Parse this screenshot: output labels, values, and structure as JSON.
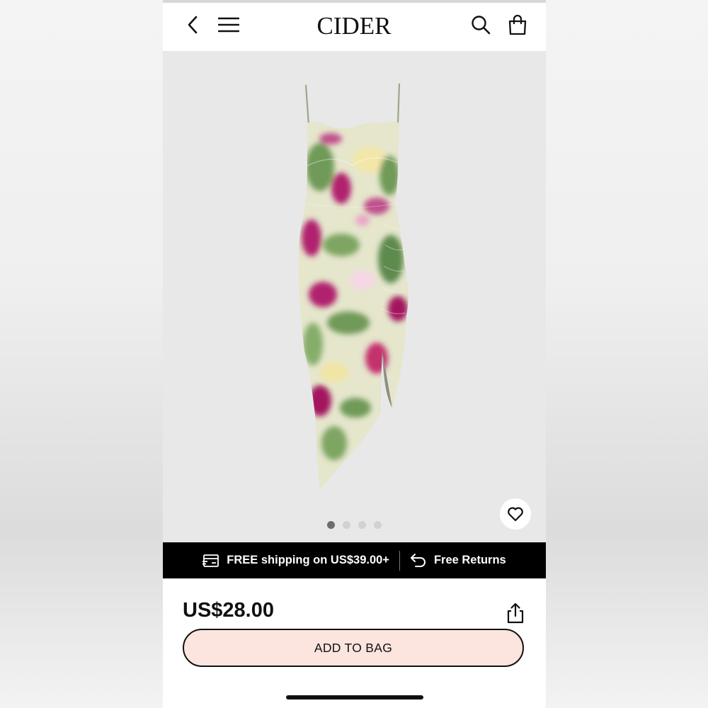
{
  "header": {
    "logo": "CIDER",
    "icons": [
      "back-arrow-icon",
      "hamburger-menu-icon",
      "search-icon",
      "shopping-bag-icon"
    ]
  },
  "gallery": {
    "total_images": 4,
    "current_index": 1,
    "favorite_icon": "heart-icon"
  },
  "shipping_bar": {
    "shipping_text": "FREE shipping on US$39.00+",
    "returns_text": "Free Returns",
    "shipping_icon": "shipping-card-icon",
    "returns_icon": "return-arrow-icon"
  },
  "product": {
    "price": "US$28.00",
    "share_icon": "share-icon",
    "add_to_bag_label": "ADD TO BAG"
  },
  "colors": {
    "add_to_bag_bg": "#fce4df",
    "shipping_bar_bg": "#000000",
    "gallery_bg": "#e8e8e8",
    "print_magenta": "#b0206e",
    "print_green": "#6f9a58",
    "print_cream": "#f3eed2"
  }
}
